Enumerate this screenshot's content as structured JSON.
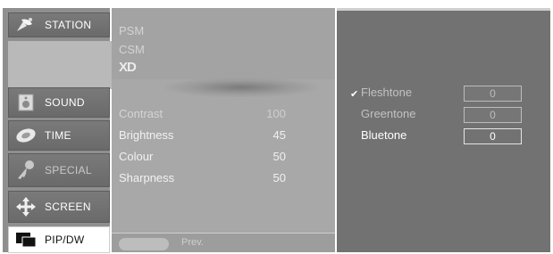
{
  "sidebar": {
    "items": [
      {
        "label": "STATION",
        "icon": "satellite-dish-icon"
      },
      {
        "label": "SOUND",
        "icon": "speaker-icon"
      },
      {
        "label": "TIME",
        "icon": "clock-icon"
      },
      {
        "label": "SPECIAL",
        "icon": "key-icon"
      },
      {
        "label": "SCREEN",
        "icon": "move-arrows-icon"
      },
      {
        "label": "PIP/DW",
        "icon": "pip-windows-icon"
      }
    ]
  },
  "picture_menu": {
    "psm_label": "PSM",
    "csm_label": "CSM",
    "xd_label": "XD",
    "settings": [
      {
        "label": "Contrast",
        "value": "100"
      },
      {
        "label": "Brightness",
        "value": "45"
      },
      {
        "label": "Colour",
        "value": "50"
      },
      {
        "label": "Sharpness",
        "value": "50"
      }
    ],
    "prev_label": "Prev."
  },
  "tone_menu": {
    "check_mark": "✔",
    "options": [
      {
        "label": "Fleshtone",
        "value": "0"
      },
      {
        "label": "Greentone",
        "value": "0"
      },
      {
        "label": "Bluetone",
        "value": "0"
      }
    ]
  }
}
